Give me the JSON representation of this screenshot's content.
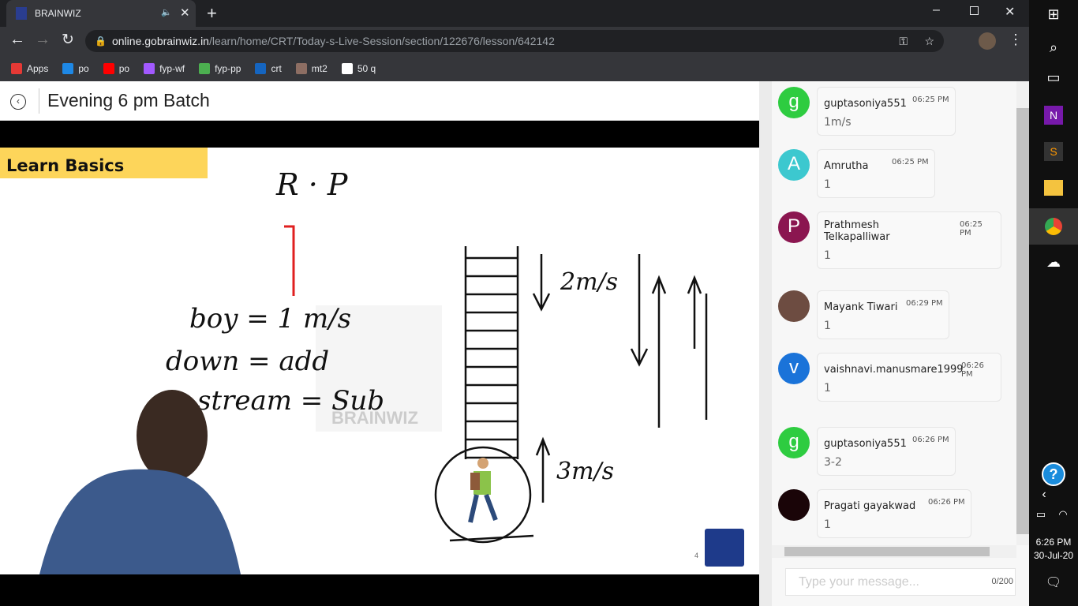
{
  "browser": {
    "tab_title": "BRAINWIZ",
    "url_host": "online.gobrainwiz.in",
    "url_path": "/learn/home/CRT/Today-s-Live-Session/section/122676/lesson/642142",
    "bookmarks": [
      {
        "label": "Apps",
        "color": "#e53935"
      },
      {
        "label": "po",
        "color": "#1e88e5"
      },
      {
        "label": "po",
        "color": "#ff0000"
      },
      {
        "label": "fyp-wf",
        "color": "#a259ff"
      },
      {
        "label": "fyp-pp",
        "color": "#4caf50"
      },
      {
        "label": "crt",
        "color": "#1565c0"
      },
      {
        "label": "mt2",
        "color": "#8d6e63"
      },
      {
        "label": "50 q",
        "color": "#ffffff"
      }
    ]
  },
  "header": {
    "title": "Evening 6 pm Batch"
  },
  "slide": {
    "banner": "Learn Basics",
    "top_note": "R · P",
    "lines": [
      "boy = 1 m/s",
      "down = add",
      "stream = Sub"
    ],
    "down_speed": "2m/s",
    "up_speed": "3m/s",
    "watermark": "BRAINWIZ",
    "page_number": "4",
    "logo_text": "BRAINWIZ"
  },
  "chat": {
    "messages": [
      {
        "initial": "g",
        "color": "#2ecc40",
        "name": "guptasoniya551",
        "time": "06:25 PM",
        "text": "1m/s"
      },
      {
        "initial": "A",
        "color": "#3cc8cf",
        "name": "Amrutha",
        "time": "06:25 PM",
        "text": "1"
      },
      {
        "initial": "P",
        "color": "#8b1650",
        "name": "Prathmesh Telkapalliwar",
        "time": "06:25 PM",
        "text": "1"
      },
      {
        "initial": "",
        "color": "#6d4c41",
        "name": "Mayank Tiwari",
        "time": "06:29 PM",
        "text": "1"
      },
      {
        "initial": "v",
        "color": "#1a73d9",
        "name": "vaishnavi.manusmare1999",
        "time": "06:26 PM",
        "text": "1"
      },
      {
        "initial": "g",
        "color": "#2ecc40",
        "name": "guptasoniya551",
        "time": "06:26 PM",
        "text": "3-2"
      },
      {
        "initial": "",
        "color": "#1a0508",
        "name": "Pragati gayakwad",
        "time": "06:26 PM",
        "text": "1"
      }
    ],
    "input_placeholder": "Type your message...",
    "char_count": "0/200"
  },
  "taskbar": {
    "time": "6:26 PM",
    "date": "30-Jul-20"
  }
}
